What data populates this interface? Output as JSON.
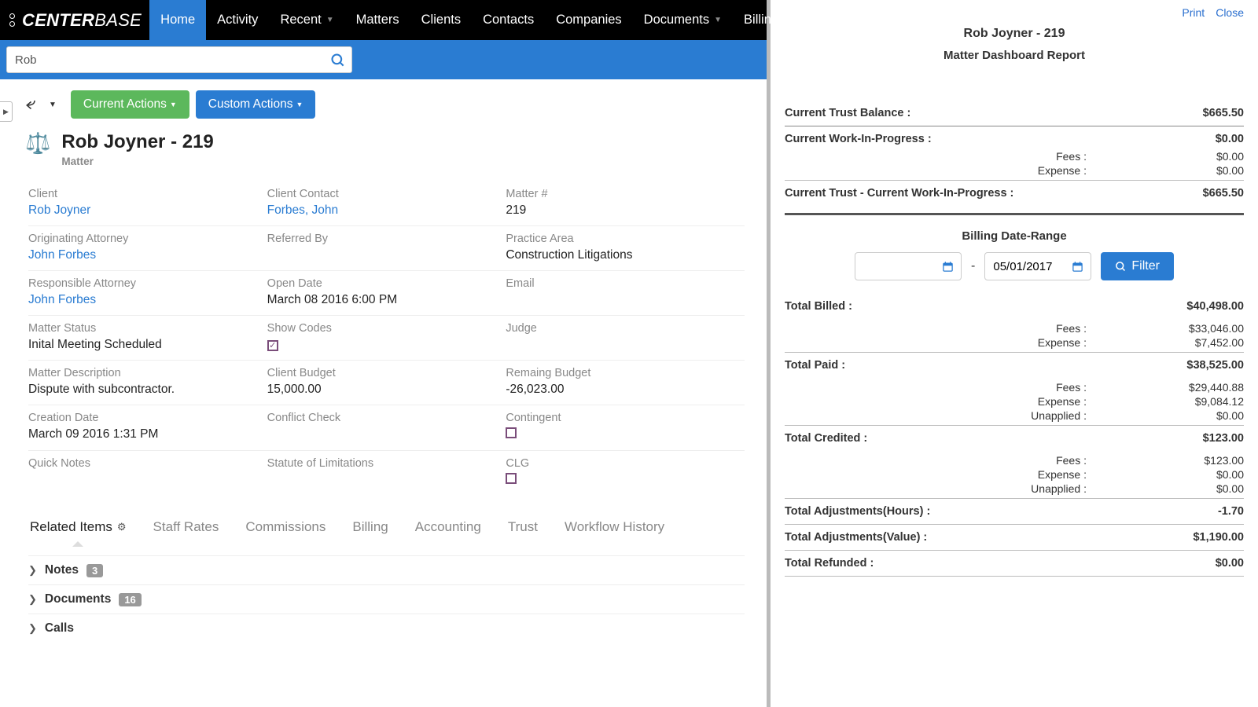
{
  "brand": {
    "strong": "CENTER",
    "thin": "BASE"
  },
  "nav": {
    "home": "Home",
    "activity": "Activity",
    "recent": "Recent",
    "matters": "Matters",
    "clients": "Clients",
    "contacts": "Contacts",
    "companies": "Companies",
    "documents": "Documents",
    "billing": "Billing"
  },
  "search": {
    "value": "Rob"
  },
  "actions": {
    "current": "Current Actions",
    "custom": "Custom Actions"
  },
  "record": {
    "title": "Rob Joyner - 219",
    "subtype": "Matter",
    "fields": {
      "client_l": "Client",
      "client_v": "Rob Joyner",
      "client_contact_l": "Client Contact",
      "client_contact_v": "Forbes, John",
      "matter_num_l": "Matter #",
      "matter_num_v": "219",
      "orig_atty_l": "Originating Attorney",
      "orig_atty_v": "John Forbes",
      "referred_by_l": "Referred By",
      "referred_by_v": "",
      "practice_area_l": "Practice Area",
      "practice_area_v": "Construction Litigations",
      "resp_atty_l": "Responsible Attorney",
      "resp_atty_v": "John Forbes",
      "open_date_l": "Open Date",
      "open_date_v": "March 08 2016 6:00 PM",
      "email_l": "Email",
      "email_v": "",
      "matter_status_l": "Matter Status",
      "matter_status_v": "Inital Meeting Scheduled",
      "show_codes_l": "Show Codes",
      "judge_l": "Judge",
      "judge_v": "",
      "matter_desc_l": "Matter Description",
      "matter_desc_v": "Dispute with subcontractor.",
      "client_budget_l": "Client Budget",
      "client_budget_v": "15,000.00",
      "remain_budget_l": "Remaing Budget",
      "remain_budget_v": "-26,023.00",
      "creation_date_l": "Creation Date",
      "creation_date_v": "March 09 2016 1:31 PM",
      "conflict_check_l": "Conflict Check",
      "conflict_check_v": "",
      "contingent_l": "Contingent",
      "quick_notes_l": "Quick Notes",
      "quick_notes_v": "",
      "sol_l": "Statute of Limitations",
      "sol_v": "",
      "clg_l": "CLG"
    }
  },
  "tabs": {
    "related": "Related Items",
    "staff_rates": "Staff Rates",
    "commissions": "Commissions",
    "billing": "Billing",
    "accounting": "Accounting",
    "trust": "Trust",
    "workflow": "Workflow History"
  },
  "related": {
    "notes_l": "Notes",
    "notes_c": "3",
    "docs_l": "Documents",
    "docs_c": "16",
    "calls_l": "Calls"
  },
  "report": {
    "print": "Print",
    "close": "Close",
    "title": "Rob Joyner - 219",
    "subtitle": "Matter Dashboard Report",
    "trust_balance_l": "Current Trust Balance :",
    "trust_balance_v": "$665.50",
    "wip_l": "Current Work-In-Progress :",
    "wip_v": "$0.00",
    "wip_fees_l": "Fees :",
    "wip_fees_v": "$0.00",
    "wip_exp_l": "Expense :",
    "wip_exp_v": "$0.00",
    "trust_minus_wip_l": "Current Trust - Current Work-In-Progress :",
    "trust_minus_wip_v": "$665.50",
    "date_range_l": "Billing Date-Range",
    "date_from": "",
    "date_to": "05/01/2017",
    "dash": "-",
    "filter": "Filter",
    "total_billed_l": "Total Billed :",
    "total_billed_v": "$40,498.00",
    "tb_fees_l": "Fees :",
    "tb_fees_v": "$33,046.00",
    "tb_exp_l": "Expense :",
    "tb_exp_v": "$7,452.00",
    "total_paid_l": "Total Paid :",
    "total_paid_v": "$38,525.00",
    "tp_fees_l": "Fees :",
    "tp_fees_v": "$29,440.88",
    "tp_exp_l": "Expense :",
    "tp_exp_v": "$9,084.12",
    "tp_unapp_l": "Unapplied :",
    "tp_unapp_v": "$0.00",
    "total_credited_l": "Total Credited :",
    "total_credited_v": "$123.00",
    "tc_fees_l": "Fees :",
    "tc_fees_v": "$123.00",
    "tc_exp_l": "Expense :",
    "tc_exp_v": "$0.00",
    "tc_unapp_l": "Unapplied :",
    "tc_unapp_v": "$0.00",
    "adj_hours_l": "Total Adjustments(Hours) :",
    "adj_hours_v": "-1.70",
    "adj_value_l": "Total Adjustments(Value) :",
    "adj_value_v": "$1,190.00",
    "refunded_l": "Total Refunded :",
    "refunded_v": "$0.00"
  }
}
